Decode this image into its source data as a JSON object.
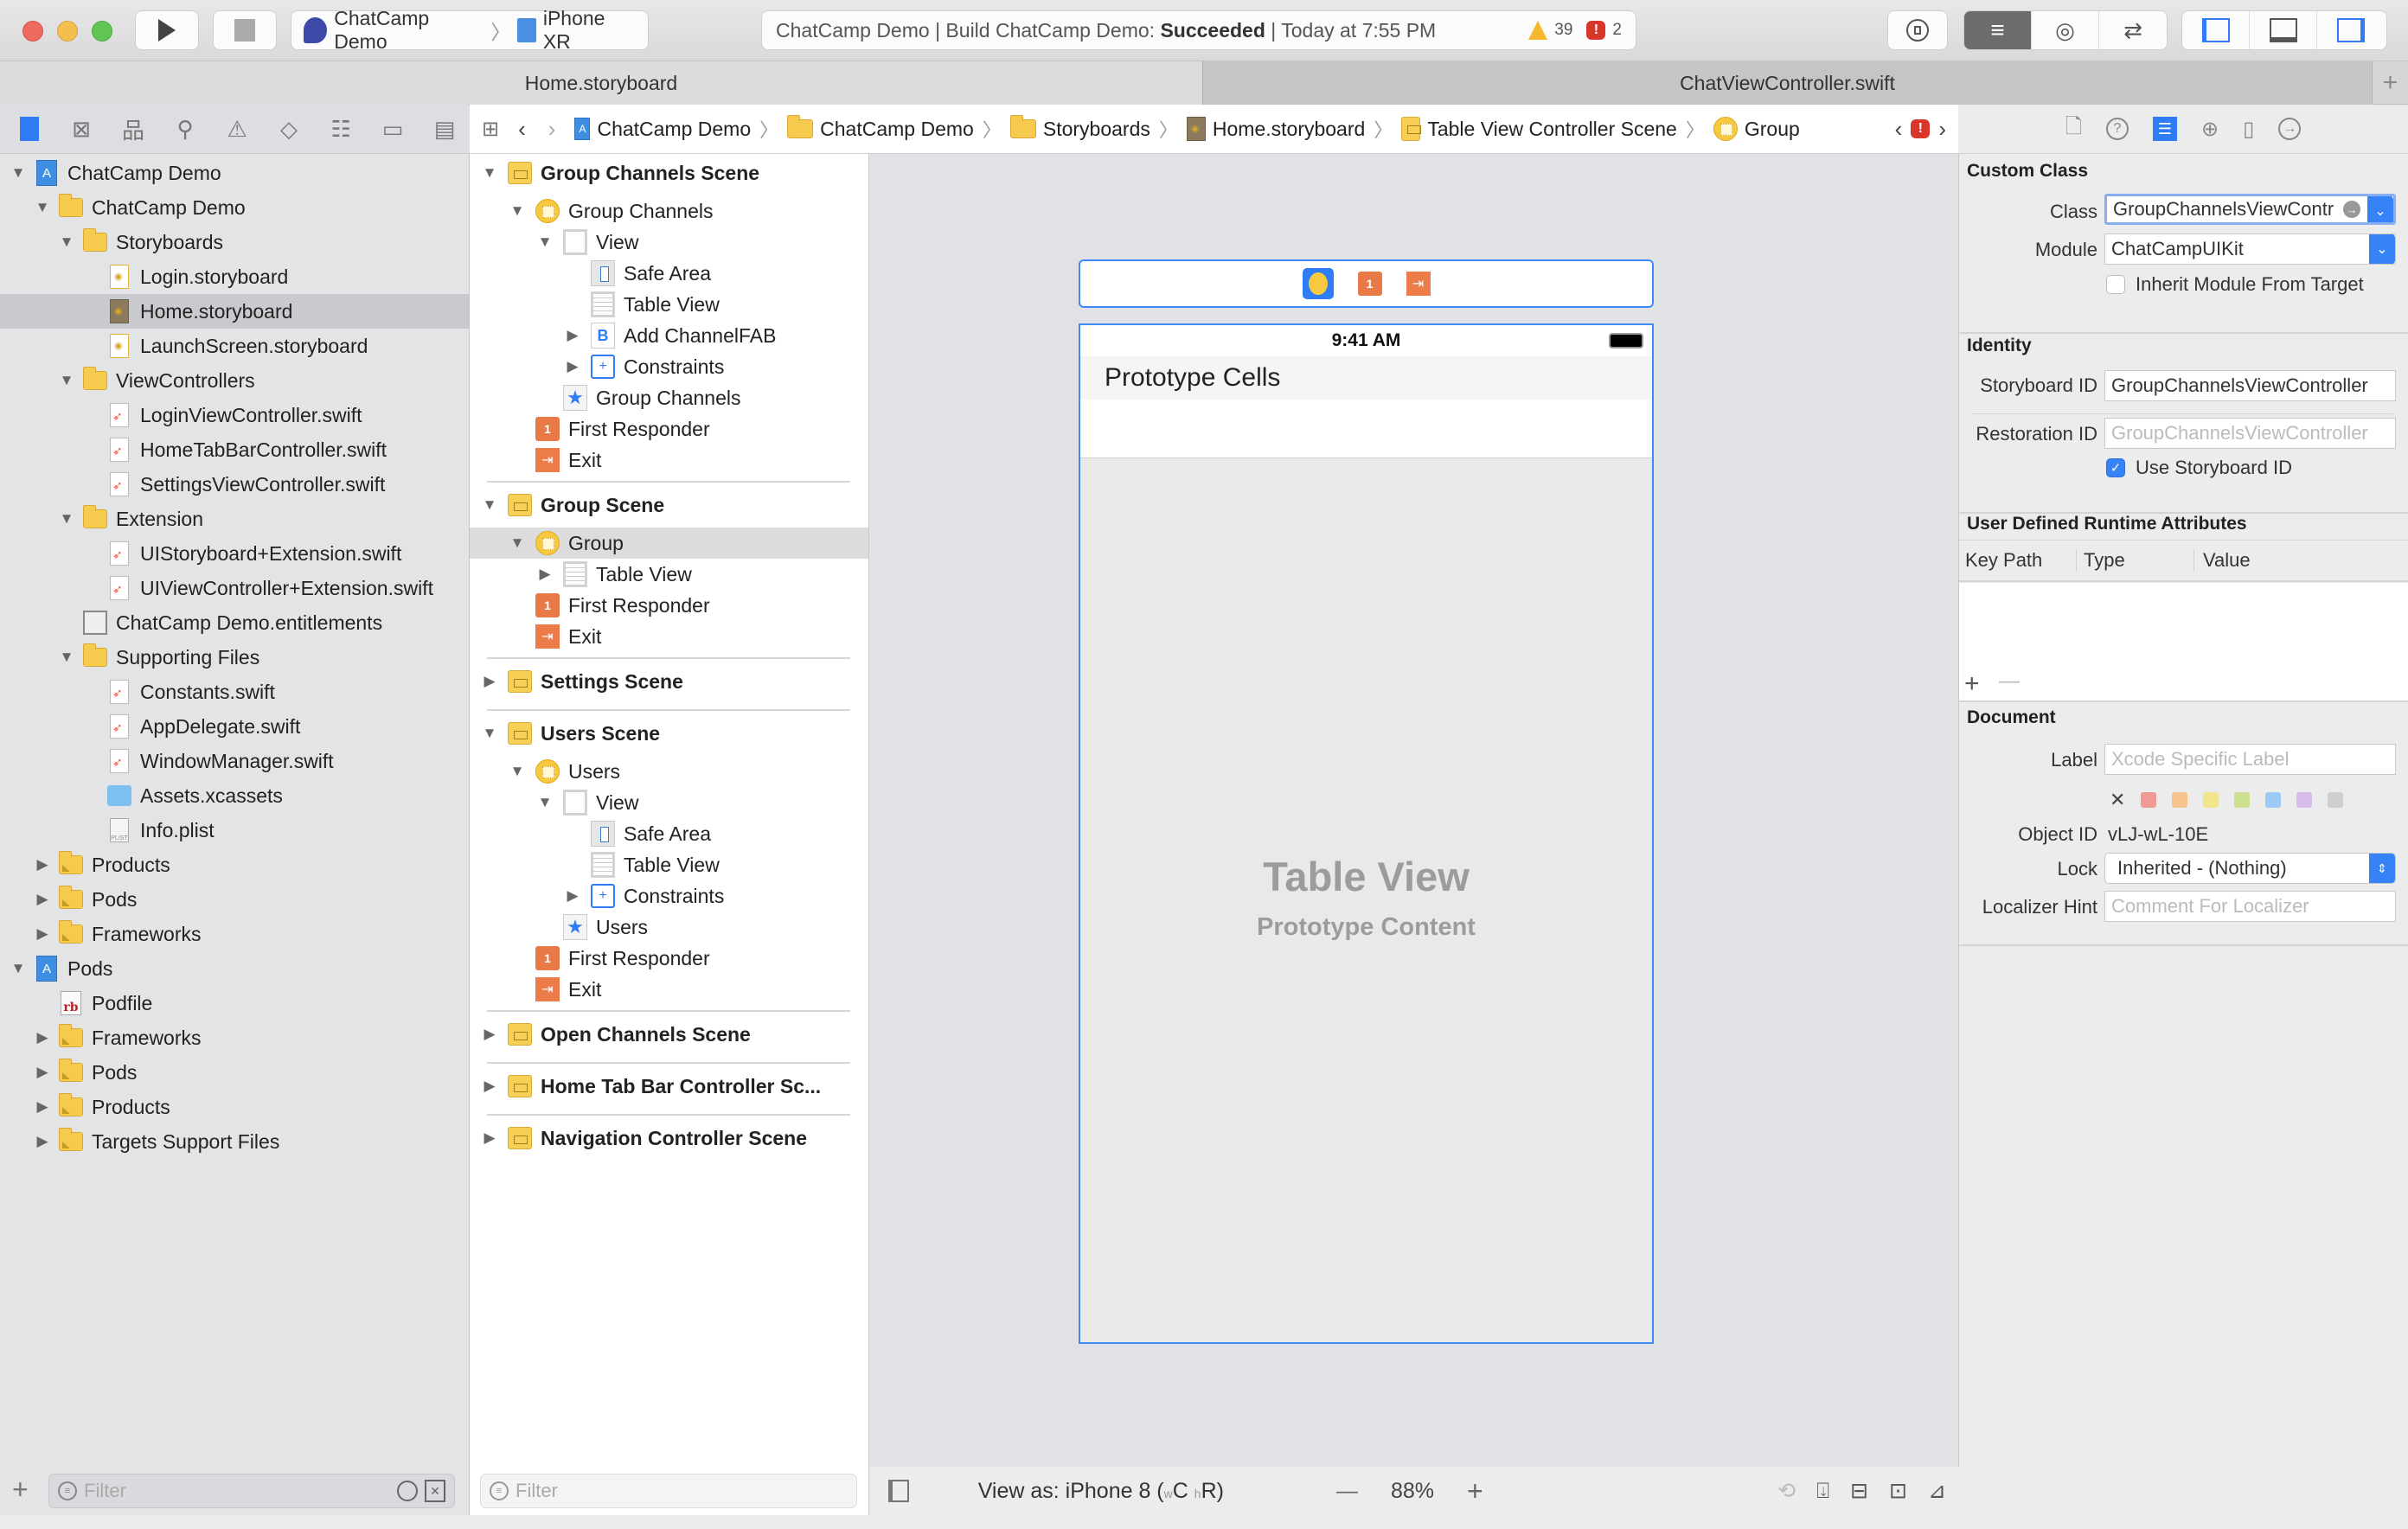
{
  "toolbar": {
    "scheme": "ChatCamp Demo",
    "device": "iPhone XR",
    "status_prefix": "ChatCamp Demo | Build ChatCamp Demo: ",
    "status_result": "Succeeded",
    "status_time": " | Today at 7:55 PM",
    "warnings": "39",
    "errors": "2"
  },
  "tabs": [
    {
      "label": "Home.storyboard",
      "active": true
    },
    {
      "label": "ChatViewController.swift",
      "active": false
    }
  ],
  "navigator": {
    "items": [
      {
        "label": "ChatCamp Demo",
        "icon": "project-icon",
        "level": 0,
        "disclosure": "open"
      },
      {
        "label": "ChatCamp Demo",
        "icon": "folder-icon",
        "level": 1,
        "disclosure": "open"
      },
      {
        "label": "Storyboards",
        "icon": "folder-icon",
        "level": 2,
        "disclosure": "open"
      },
      {
        "label": "Login.storyboard",
        "icon": "storyboard-icon",
        "level": 3,
        "disclosure": "none"
      },
      {
        "label": "Home.storyboard",
        "icon": "storyboard-icon",
        "level": 3,
        "disclosure": "none",
        "selected": true
      },
      {
        "label": "LaunchScreen.storyboard",
        "icon": "storyboard-icon",
        "level": 3,
        "disclosure": "none"
      },
      {
        "label": "ViewControllers",
        "icon": "folder-icon",
        "level": 2,
        "disclosure": "open"
      },
      {
        "label": "LoginViewController.swift",
        "icon": "swift-file-icon",
        "level": 3,
        "disclosure": "none"
      },
      {
        "label": "HomeTabBarController.swift",
        "icon": "swift-file-icon",
        "level": 3,
        "disclosure": "none"
      },
      {
        "label": "SettingsViewController.swift",
        "icon": "swift-file-icon",
        "level": 3,
        "disclosure": "none"
      },
      {
        "label": "Extension",
        "icon": "folder-icon",
        "level": 2,
        "disclosure": "open"
      },
      {
        "label": "UIStoryboard+Extension.swift",
        "icon": "swift-file-icon",
        "level": 3,
        "disclosure": "none"
      },
      {
        "label": "UIViewController+Extension.swift",
        "icon": "swift-file-icon",
        "level": 3,
        "disclosure": "none"
      },
      {
        "label": "ChatCamp Demo.entitlements",
        "icon": "entitlements-icon",
        "level": 2,
        "disclosure": "none"
      },
      {
        "label": "Supporting Files",
        "icon": "folder-icon",
        "level": 2,
        "disclosure": "open"
      },
      {
        "label": "Constants.swift",
        "icon": "swift-file-icon",
        "level": 3,
        "disclosure": "none"
      },
      {
        "label": "AppDelegate.swift",
        "icon": "swift-file-icon",
        "level": 3,
        "disclosure": "none"
      },
      {
        "label": "WindowManager.swift",
        "icon": "swift-file-icon",
        "level": 3,
        "disclosure": "none"
      },
      {
        "label": "Assets.xcassets",
        "icon": "asset-catalog-icon",
        "level": 3,
        "disclosure": "none"
      },
      {
        "label": "Info.plist",
        "icon": "plist-icon",
        "level": 3,
        "disclosure": "none"
      },
      {
        "label": "Products",
        "icon": "group-folder-icon",
        "level": 1,
        "disclosure": "closed"
      },
      {
        "label": "Pods",
        "icon": "group-folder-icon",
        "level": 1,
        "disclosure": "closed"
      },
      {
        "label": "Frameworks",
        "icon": "group-folder-icon",
        "level": 1,
        "disclosure": "closed"
      },
      {
        "label": "Pods",
        "icon": "project-icon",
        "level": 0,
        "disclosure": "open"
      },
      {
        "label": "Podfile",
        "icon": "ruby-file-icon",
        "level": 1,
        "disclosure": "none"
      },
      {
        "label": "Frameworks",
        "icon": "group-folder-icon",
        "level": 1,
        "disclosure": "closed"
      },
      {
        "label": "Pods",
        "icon": "group-folder-icon",
        "level": 1,
        "disclosure": "closed"
      },
      {
        "label": "Products",
        "icon": "group-folder-icon",
        "level": 1,
        "disclosure": "closed"
      },
      {
        "label": "Targets Support Files",
        "icon": "group-folder-icon",
        "level": 1,
        "disclosure": "closed"
      }
    ],
    "filter_placeholder": "Filter"
  },
  "jumpbar": {
    "crumbs": [
      {
        "label": "ChatCamp Demo",
        "icon": "project-icon"
      },
      {
        "label": "ChatCamp Demo",
        "icon": "folder-icon"
      },
      {
        "label": "Storyboards",
        "icon": "folder-icon"
      },
      {
        "label": "Home.storyboard",
        "icon": "storyboard-icon"
      },
      {
        "label": "Table View Controller Scene",
        "icon": "scene-icon"
      },
      {
        "label": "Group",
        "icon": "view-controller-icon"
      }
    ]
  },
  "outline": {
    "filter_placeholder": "Filter",
    "rows": [
      {
        "label": "Group Channels Scene",
        "icon": "scene",
        "level": 0,
        "disclosure": "open",
        "scene": true
      },
      {
        "label": "Group Channels",
        "icon": "vc",
        "level": 1,
        "disclosure": "open"
      },
      {
        "label": "View",
        "icon": "view",
        "level": 2,
        "disclosure": "open"
      },
      {
        "label": "Safe Area",
        "icon": "safe",
        "level": 3,
        "disclosure": "none"
      },
      {
        "label": "Table View",
        "icon": "table",
        "level": 3,
        "disclosure": "none"
      },
      {
        "label": "Add ChannelFAB",
        "icon": "button",
        "level": 3,
        "disclosure": "closed"
      },
      {
        "label": "Constraints",
        "icon": "constraints",
        "level": 3,
        "disclosure": "closed"
      },
      {
        "label": "Group Channels",
        "icon": "star",
        "level": 2,
        "disclosure": "none"
      },
      {
        "label": "First Responder",
        "icon": "responder",
        "level": 1,
        "disclosure": "none"
      },
      {
        "label": "Exit",
        "icon": "exit",
        "level": 1,
        "disclosure": "none"
      },
      {
        "divider": true
      },
      {
        "label": "Group Scene",
        "icon": "scene",
        "level": 0,
        "disclosure": "open",
        "scene": true
      },
      {
        "label": "Group",
        "icon": "vc-table",
        "level": 1,
        "disclosure": "open",
        "selected": true
      },
      {
        "label": "Table View",
        "icon": "table",
        "level": 2,
        "disclosure": "closed"
      },
      {
        "label": "First Responder",
        "icon": "responder",
        "level": 1,
        "disclosure": "none"
      },
      {
        "label": "Exit",
        "icon": "exit",
        "level": 1,
        "disclosure": "none"
      },
      {
        "divider": true
      },
      {
        "label": "Settings Scene",
        "icon": "scene",
        "level": 0,
        "disclosure": "closed",
        "scene": true
      },
      {
        "divider": true
      },
      {
        "label": "Users Scene",
        "icon": "scene",
        "level": 0,
        "disclosure": "open",
        "scene": true
      },
      {
        "label": "Users",
        "icon": "vc",
        "level": 1,
        "disclosure": "open"
      },
      {
        "label": "View",
        "icon": "view",
        "level": 2,
        "disclosure": "open"
      },
      {
        "label": "Safe Area",
        "icon": "safe",
        "level": 3,
        "disclosure": "none"
      },
      {
        "label": "Table View",
        "icon": "table",
        "level": 3,
        "disclosure": "none"
      },
      {
        "label": "Constraints",
        "icon": "constraints",
        "level": 3,
        "disclosure": "closed"
      },
      {
        "label": "Users",
        "icon": "star",
        "level": 2,
        "disclosure": "none"
      },
      {
        "label": "First Responder",
        "icon": "responder",
        "level": 1,
        "disclosure": "none"
      },
      {
        "label": "Exit",
        "icon": "exit",
        "level": 1,
        "disclosure": "none"
      },
      {
        "divider": true
      },
      {
        "label": "Open Channels Scene",
        "icon": "scene",
        "level": 0,
        "disclosure": "closed",
        "scene": true
      },
      {
        "divider": true
      },
      {
        "label": "Home Tab Bar Controller Sc...",
        "icon": "scene",
        "level": 0,
        "disclosure": "closed",
        "scene": true
      },
      {
        "divider": true
      },
      {
        "label": "Navigation Controller Scene",
        "icon": "scene",
        "level": 0,
        "disclosure": "closed",
        "scene": true
      }
    ]
  },
  "canvas": {
    "status_time": "9:41 AM",
    "header": "Prototype Cells",
    "placeholder_title": "Table View",
    "placeholder_subtitle": "Prototype Content"
  },
  "bottombar": {
    "view_as_prefix": "View as: iPhone 8 (",
    "size_w": "w",
    "size_c": "C",
    "size_h": "h",
    "size_r": "R",
    "view_as_suffix": ")",
    "zoom": "88%",
    "zoom_out": "—",
    "zoom_in": "+"
  },
  "inspector": {
    "custom_class": {
      "title": "Custom Class",
      "class_label": "Class",
      "class_value": "GroupChannelsViewContr",
      "module_label": "Module",
      "module_value": "ChatCampUIKit",
      "inherit_label": "Inherit Module From Target",
      "inherit_checked": false
    },
    "identity": {
      "title": "Identity",
      "storyboard_id_label": "Storyboard ID",
      "storyboard_id_value": "GroupChannelsViewController",
      "restoration_id_label": "Restoration ID",
      "restoration_id_placeholder": "GroupChannelsViewController",
      "use_storyboard_id_label": "Use Storyboard ID",
      "use_storyboard_id_checked": true
    },
    "runtime_attrs": {
      "title": "User Defined Runtime Attributes",
      "columns": [
        "Key Path",
        "Type",
        "Value"
      ],
      "add": "+",
      "remove": "—"
    },
    "document": {
      "title": "Document",
      "label_label": "Label",
      "label_placeholder": "Xcode Specific Label",
      "colors": [
        "#ef9a94",
        "#f6c48c",
        "#f3e58e",
        "#cde08f",
        "#9ccaf6",
        "#d6bde9",
        "#cfcfcf"
      ],
      "object_id_label": "Object ID",
      "object_id_value": "vLJ-wL-10E",
      "lock_label": "Lock",
      "lock_value": "Inherited - (Nothing)",
      "localizer_label": "Localizer Hint",
      "localizer_placeholder": "Comment For Localizer"
    }
  }
}
